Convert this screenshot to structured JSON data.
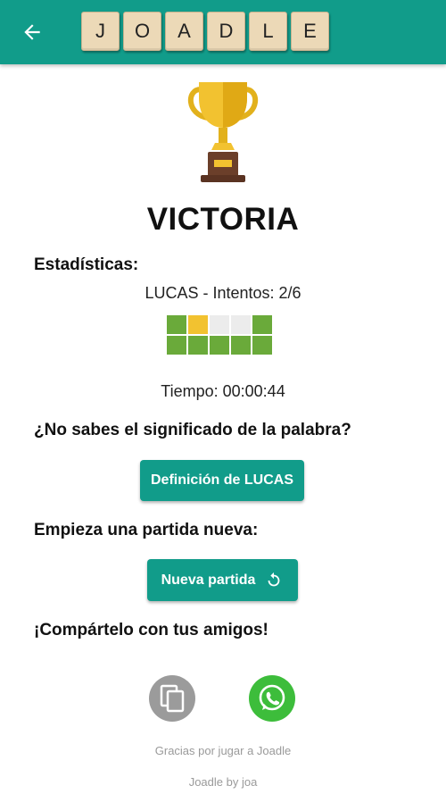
{
  "header": {
    "back_icon": "arrow-left-icon",
    "logo_letters": [
      "J",
      "O",
      "A",
      "D",
      "L",
      "E"
    ],
    "bar_color": "#119c8a"
  },
  "result": {
    "title": "VICTORIA",
    "stats_label": "Estadísticas:",
    "word_attempts": "LUCAS - Intentos: 2/6",
    "time": "Tiempo: 00:00:44",
    "attempt_grid": [
      [
        "green",
        "yellow",
        "gray",
        "gray",
        "green"
      ],
      [
        "green",
        "green",
        "green",
        "green",
        "green"
      ]
    ],
    "colors": {
      "green": "#6aaa3a",
      "yellow": "#f2c230",
      "gray": "#ececec"
    }
  },
  "definition": {
    "question": "¿No sabes el significado de la palabra?",
    "button_label": "Definición de LUCAS"
  },
  "new_game": {
    "label": "Empieza una partida nueva:",
    "button_label": "Nueva partida",
    "button_icon": "refresh-icon"
  },
  "share": {
    "label": "¡Compártelo con tus amigos!",
    "copy_icon": "copy-icon",
    "whatsapp_icon": "whatsapp-icon"
  },
  "footer": {
    "thanks": "Gracias por jugar a Joadle",
    "credit": "Joadle by joa"
  }
}
